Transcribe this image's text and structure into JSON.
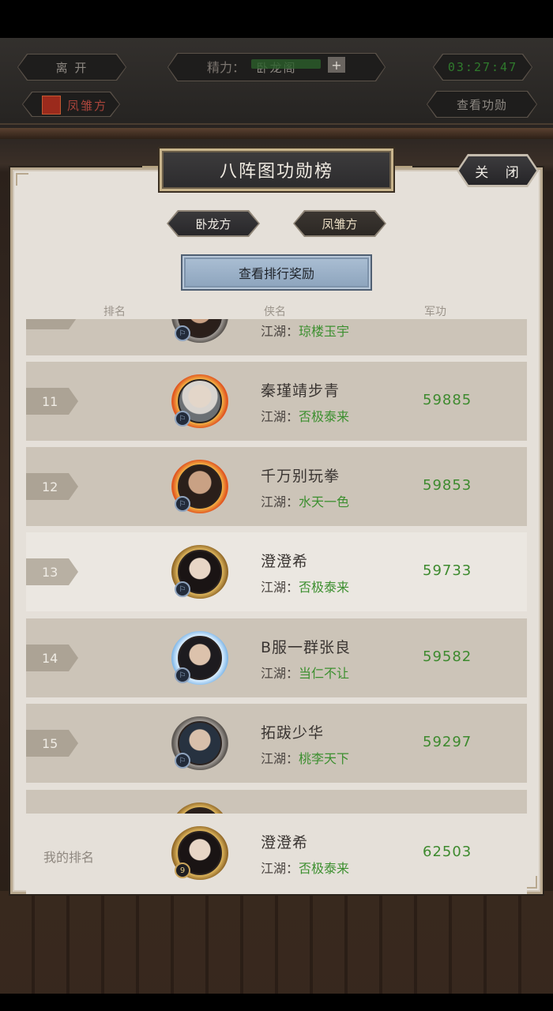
{
  "background": {
    "leave_label": "离 开",
    "location_title": "卧龙阁",
    "timer": "03:27:47",
    "faction_label": "凤雏方",
    "stamina_label": "精力：",
    "stamina_plus": "+",
    "view_merit_label": "查看功勋"
  },
  "modal": {
    "title": "八阵图功勋榜",
    "close_label": "关 闭",
    "tabs": [
      {
        "label": "卧龙方",
        "active": true
      },
      {
        "label": "凤雏方",
        "active": false
      }
    ],
    "reward_button_label": "查看排行奖励",
    "columns": {
      "rank": "排名",
      "name": "侠名",
      "merit": "军功"
    }
  },
  "ranking": {
    "server_prefix": "江湖：",
    "rows": [
      {
        "rank": "",
        "name": "",
        "server": "琼楼玉宇",
        "merit": "",
        "frame": "silver",
        "portrait": "dark",
        "partial": "top"
      },
      {
        "rank": "11",
        "name": "秦瑾靖步青",
        "server": "否极泰来",
        "merit": "59885",
        "frame": "fire",
        "portrait": "white"
      },
      {
        "rank": "12",
        "name": "千万别玩拳",
        "server": "水天一色",
        "merit": "59853",
        "frame": "fire",
        "portrait": "dark"
      },
      {
        "rank": "13",
        "name": "澄澄希",
        "server": "否极泰来",
        "merit": "59733",
        "frame": "gold",
        "portrait": "lady",
        "self": true
      },
      {
        "rank": "14",
        "name": "B服一群张良",
        "server": "当仁不让",
        "merit": "59582",
        "frame": "ice",
        "portrait": "blue"
      },
      {
        "rank": "15",
        "name": "拓跋少华",
        "server": "桃李天下",
        "merit": "59297",
        "frame": "silver",
        "portrait": "teal"
      },
      {
        "rank": "",
        "name": "",
        "server": "",
        "merit": "",
        "frame": "gold",
        "portrait": "dark",
        "partial": "bottom"
      }
    ]
  },
  "my_rank": {
    "label": "我的排名",
    "name": "澄澄希",
    "server": "否极泰来",
    "merit": "62503",
    "level": "9"
  },
  "colors": {
    "panel_bg": "#e5e0d9",
    "row_bg": "#ccc4b8",
    "self_row_bg": "#ebe7e1",
    "server_green": "#3c8f2f",
    "reward_button": "#a9bdd2"
  }
}
